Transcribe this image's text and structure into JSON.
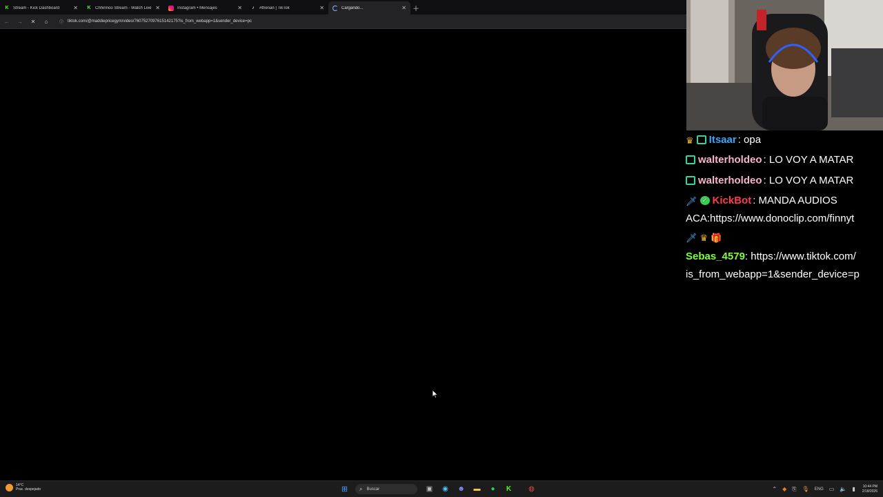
{
  "browser": {
    "tabs": [
      {
        "label": "Stream - Kick Dashboard",
        "favicon": "kick-icon"
      },
      {
        "label": "Chhinnoo Stream - Watch Live",
        "favicon": "kick-icon"
      },
      {
        "label": "Instagram • Mensajes",
        "favicon": "instagram-icon"
      },
      {
        "label": "#therian | TikTok",
        "favicon": "tiktok-icon"
      },
      {
        "label": "Cargando...",
        "favicon": "loading-spinner-icon"
      }
    ],
    "active_tab": 4,
    "url": "tiktok.com/@maddiepricegym/video/7607527097615142175?is_from_webapp=1&sender_device=pc"
  },
  "chat": {
    "messages": [
      {
        "user": "Itsaar",
        "text": ": opa",
        "user_color": "#3aa7ff",
        "badges": [
          "crown-icon",
          "og-badge-icon"
        ]
      },
      {
        "user": "walterholdeo",
        "text": ": LO VOY A MATAR",
        "user_color": "#f4b6c8",
        "badges": [
          "og-badge-icon"
        ]
      },
      {
        "user": "walterholdeo",
        "text": ": LO VOY A MATAR",
        "user_color": "#f4b6c8",
        "badges": [
          "og-badge-icon"
        ]
      },
      {
        "user": "KickBot",
        "text": ": MANDA AUDIOS",
        "user_color": "#ff3b4e",
        "badges": [
          "sword-icon",
          "verified-icon"
        ],
        "continuation": "ACA:https://www.donoclip.com/finnyt"
      },
      {
        "user": "Sebas_4579",
        "text": ": https://www.tiktok.com/",
        "user_color": "#7dff3f",
        "badges": [
          "sword-icon",
          "crown-icon",
          "gift-icon"
        ],
        "continuation": "is_from_webapp=1&sender_device=p"
      }
    ]
  },
  "taskbar": {
    "weather_temp": "14°C",
    "weather_desc": "Prac. despejado",
    "search_placeholder": "Buscar",
    "lang": "ENG",
    "time": "10:44 PM",
    "date": "2/18/2026"
  },
  "colors": {
    "kick_green": "#53fc18",
    "chrome_dark": "#232326"
  }
}
